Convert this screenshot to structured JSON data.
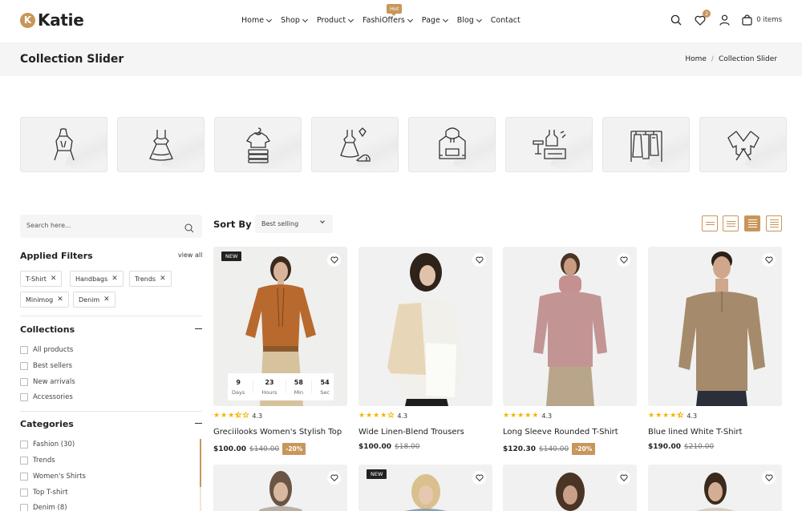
{
  "header": {
    "logo_mark": "K",
    "logo_text": "Katie",
    "nav": [
      {
        "label": "Home",
        "has_dropdown": true
      },
      {
        "label": "Shop",
        "has_dropdown": true
      },
      {
        "label": "Product",
        "has_dropdown": true
      },
      {
        "label": "FashiOffers",
        "has_dropdown": true,
        "badge": "Hot"
      },
      {
        "label": "Page",
        "has_dropdown": true
      },
      {
        "label": "Blog",
        "has_dropdown": true
      },
      {
        "label": "Contact",
        "has_dropdown": false
      }
    ],
    "wishlist_count": "2",
    "cart_label": "0 items"
  },
  "titlebar": {
    "title": "Collection Slider",
    "breadcrumb": [
      "Home",
      "Collection Slider"
    ]
  },
  "collections": [
    {
      "icon": "dress-outfit-icon"
    },
    {
      "icon": "dress-icon"
    },
    {
      "icon": "folded-tshirt-icon"
    },
    {
      "icon": "dress-heels-icon"
    },
    {
      "icon": "hoodie-icon"
    },
    {
      "icon": "accessories-set-icon"
    },
    {
      "icon": "clothes-rack-icon"
    },
    {
      "icon": "top-bow-icon"
    }
  ],
  "sidebar": {
    "search_placeholder": "Search here...",
    "applied_filters": {
      "title": "Applied Filters",
      "view_all": "view all",
      "tags": [
        "T-Shirt",
        "Handbags",
        "Trends",
        "Minimog",
        "Denim"
      ]
    },
    "collections": {
      "title": "Collections",
      "items": [
        "All products",
        "Best sellers",
        "New arrivals",
        "Accessories"
      ]
    },
    "categories": {
      "title": "Categories",
      "items": [
        "Fashion (30)",
        "Trends",
        "Women's Shirts",
        "Top T-shirt",
        "Denim (8)"
      ]
    }
  },
  "toolbar": {
    "sort_label": "Sort By :",
    "sort_value": "Best selling",
    "view_modes": [
      "grid-2",
      "grid-3",
      "grid-4",
      "list"
    ],
    "active_view": "grid-4"
  },
  "products": [
    {
      "title": "Greciilooks Women's Stylish Top",
      "rating": "4.3",
      "stars": 3.5,
      "price": "$100.00",
      "old_price": "$140.00",
      "discount": "-20%",
      "badge": "NEW",
      "countdown": [
        {
          "value": "9",
          "label": "Days"
        },
        {
          "value": "23",
          "label": "Hours"
        },
        {
          "value": "58",
          "label": "Min"
        },
        {
          "value": "54",
          "label": "Sec"
        }
      ]
    },
    {
      "title": "Wide Linen-Blend Trousers",
      "rating": "4.3",
      "stars": 4,
      "price": "$100.00",
      "old_price": "$18.00"
    },
    {
      "title": "Long Sleeve Rounded T-Shirt",
      "rating": "4.3",
      "stars": 5,
      "price": "$120.30",
      "old_price": "$140.00",
      "discount": "-20%"
    },
    {
      "title": "Blue lined White T-Shirt",
      "rating": "4.3",
      "stars": 4.5,
      "price": "$190.00",
      "old_price": "$210.00"
    }
  ],
  "products_row2": [
    {
      "badge": ""
    },
    {
      "badge": "NEW"
    },
    {
      "badge": ""
    },
    {
      "badge": ""
    }
  ],
  "colors": {
    "accent": "#c8965a",
    "star": "#f4b400",
    "badge_new": "#222222",
    "panel": "#f5f5f5"
  }
}
